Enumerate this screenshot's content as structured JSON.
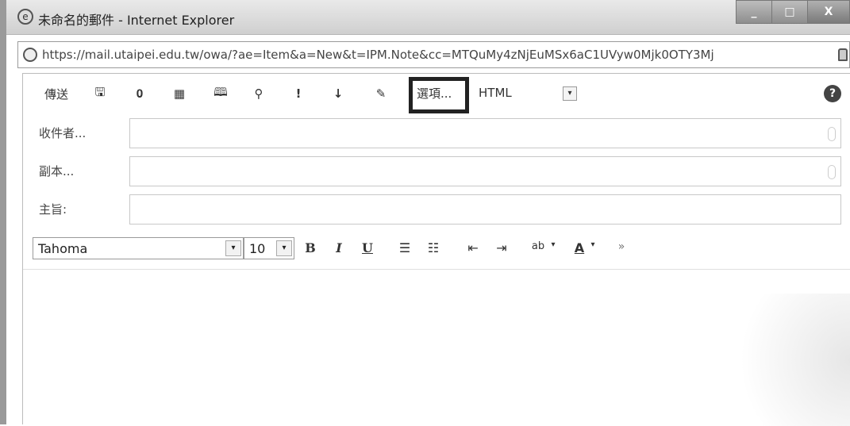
{
  "window": {
    "title": "未命名的郵件 - Internet Explorer",
    "buttons": {
      "minimize": "_",
      "maximize": "□",
      "close": "X"
    }
  },
  "address": {
    "url": "https://mail.utaipei.edu.tw/owa/?ae=Item&a=New&t=IPM.Note&cc=MTQuMy4zNjEuMSx6aC1UVyw0Mjk0OTY3Mj"
  },
  "toolbar": {
    "send_label": "傳送",
    "icons": {
      "save": "🖫",
      "attach": "𝟎",
      "insert_image": "▦",
      "address_book": "🕮",
      "check_names": "⚲",
      "high_importance": "!",
      "low_importance": "↓",
      "signature": "✎"
    },
    "options_label": "選項...",
    "format_value": "HTML",
    "help": "?"
  },
  "fields": {
    "to_label": "收件者...",
    "cc_label": "副本...",
    "subject_label": "主旨:"
  },
  "formatting": {
    "font_value": "Tahoma",
    "size_value": "10",
    "bold": "B",
    "italic": "I",
    "underline": "U",
    "bullets": "☰",
    "numbering": "☷",
    "decrease_indent": "⇤",
    "increase_indent": "⇥",
    "highlight": "ab",
    "font_color": "A",
    "more": "»",
    "dropdown_glyph": "▾"
  }
}
